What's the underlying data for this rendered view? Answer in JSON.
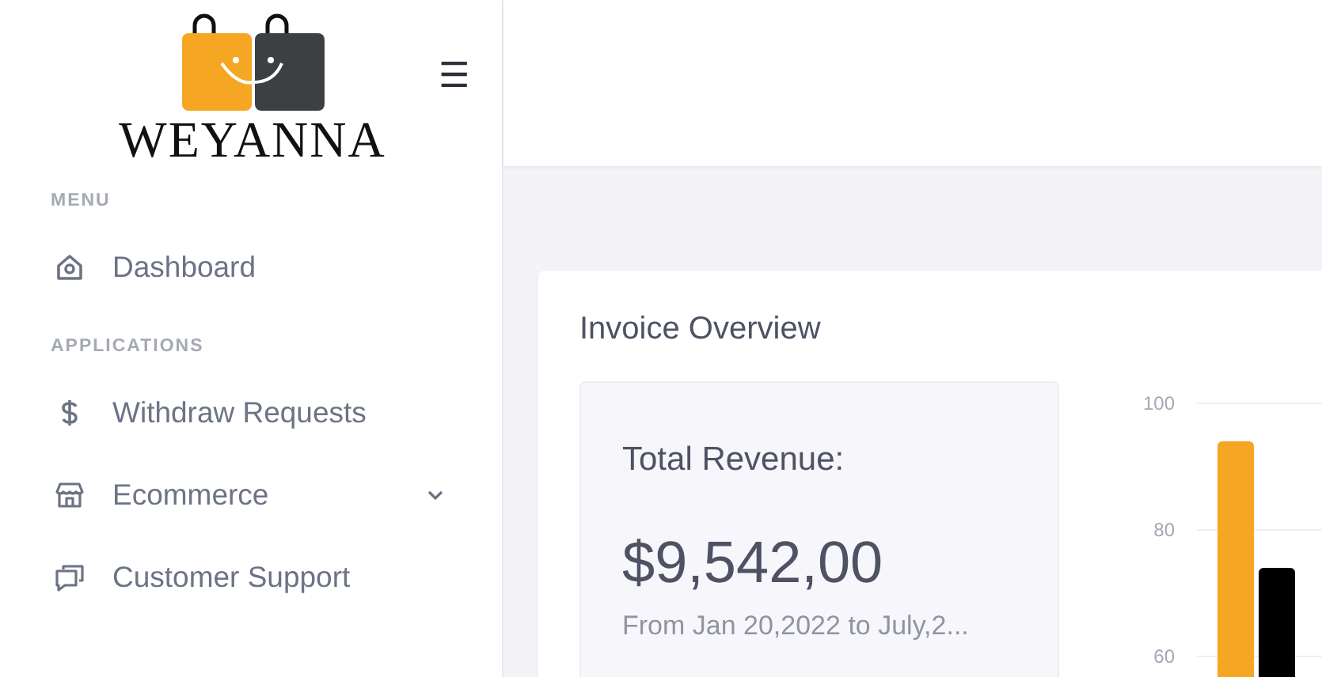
{
  "sidebar": {
    "logo_text": "WEYANNA",
    "menu_button": "☰",
    "sections": [
      {
        "title": "MENU",
        "items": [
          {
            "label": "Dashboard"
          }
        ]
      },
      {
        "title": "APPLICATIONS",
        "items": [
          {
            "label": "Withdraw Requests"
          },
          {
            "label": "Ecommerce",
            "expanded": false
          },
          {
            "label": "Customer Support"
          }
        ]
      }
    ]
  },
  "invoice_overview": {
    "title": "Invoice Overview",
    "revenue": {
      "label": "Total Revenue:",
      "amount": "$9,542,00",
      "period": "From Jan 20,2022 to July,2..."
    },
    "chart_data": {
      "type": "bar",
      "ylim": [
        0,
        100
      ],
      "yticks": [
        60,
        80,
        100
      ],
      "series": [
        {
          "color": "#f5a623",
          "values": [
            94
          ]
        },
        {
          "color": "#000000",
          "values": [
            74
          ]
        }
      ]
    }
  }
}
